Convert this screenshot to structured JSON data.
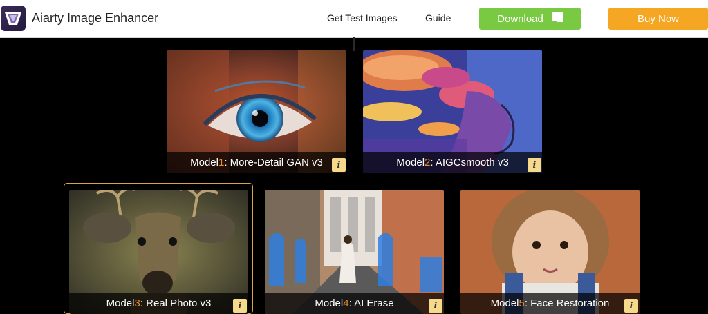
{
  "header": {
    "brand": "Aiarty Image Enhancer",
    "nav": [
      {
        "label": "Get Test Images"
      },
      {
        "label": "Guide"
      }
    ],
    "download_label": "Download",
    "buy_label": "Buy Now"
  },
  "models": [
    {
      "prefix": "Model ",
      "num": "1",
      "name": ": More-Detail GAN v3"
    },
    {
      "prefix": "Model ",
      "num": "2",
      "name": ": AIGCsmooth v3"
    },
    {
      "prefix": "Model ",
      "num": "3",
      "name": ": Real Photo v3"
    },
    {
      "prefix": "Model ",
      "num": "4",
      "name": ": AI Erase"
    },
    {
      "prefix": "Model ",
      "num": "5",
      "name": ": Face Restoration"
    }
  ],
  "info_glyph": "i",
  "colors": {
    "download": "#7ac943",
    "buy": "#f5a623",
    "model_number": "#f08a24",
    "info_badge": "#f6d98a",
    "selected_border": "#d9a441"
  },
  "icons": {
    "logo": "aiarty-logo-icon",
    "windows": "windows-icon",
    "info": "info-icon"
  }
}
